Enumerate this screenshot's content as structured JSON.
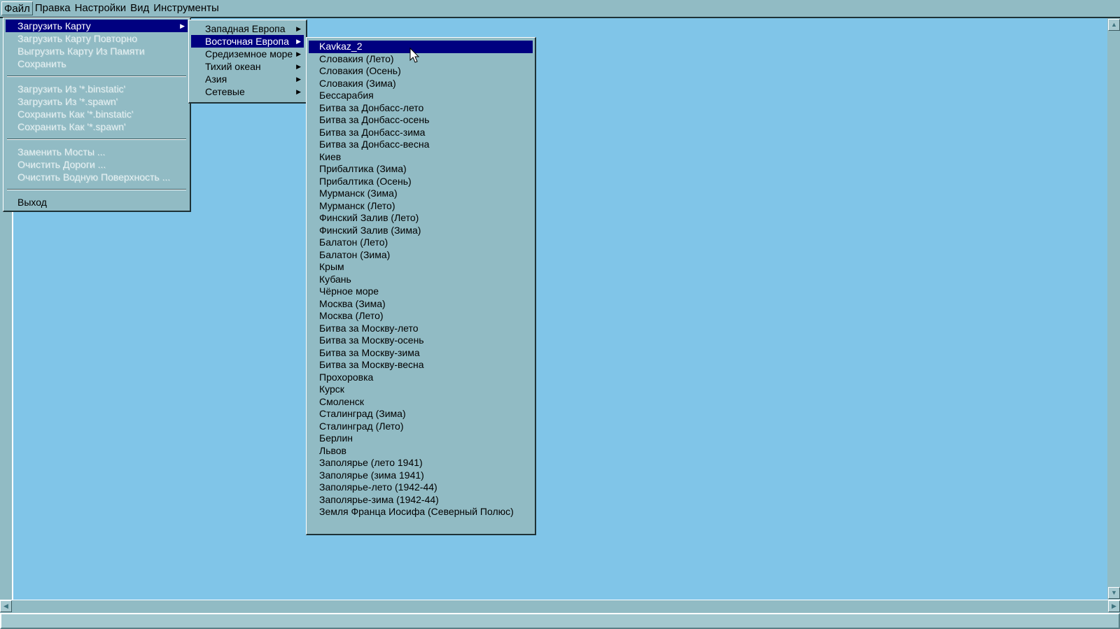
{
  "menubar": {
    "items": [
      "Файл",
      "Правка",
      "Настройки",
      "Вид",
      "Инструменты"
    ]
  },
  "file_menu": {
    "load_map": "Загрузить Карту",
    "reload_map": "Загрузить Карту Повторно",
    "unload_map": "Выгрузить Карту Из Памяти",
    "save": "Сохранить",
    "load_binstatic": "Загрузить Из '*.binstatic'",
    "load_spawn": "Загрузить Из '*.spawn'",
    "save_binstatic": "Сохранить Как '*.binstatic'",
    "save_spawn": "Сохранить Как '*.spawn'",
    "replace_bridges": "Заменить Мосты ...",
    "clear_roads": "Очистить Дороги ...",
    "clear_water": "Очистить Водную Поверхность ...",
    "exit": "Выход"
  },
  "regions_menu": {
    "items": [
      "Западная Европа",
      "Восточная Европа",
      "Средиземное море",
      "Тихий океан",
      "Азия",
      "Сетевые"
    ],
    "selected": 1
  },
  "maps_menu": {
    "selected": 0,
    "items": [
      "Kavkaz_2",
      "Словакия (Лето)",
      "Словакия (Осень)",
      "Словакия (Зима)",
      "Бессарабия",
      "Битва за Донбасс-лето",
      "Битва за Донбасс-осень",
      "Битва за Донбасс-зима",
      "Битва за Донбасс-весна",
      "Киев",
      "Прибалтика (Зима)",
      "Прибалтика (Осень)",
      "Мурманск (Зима)",
      "Мурманск (Лето)",
      "Финский Залив (Лето)",
      "Финский Залив (Зима)",
      "Балатон (Лето)",
      "Балатон (Зима)",
      "Крым",
      "Кубань",
      "Чёрное море",
      "Москва (Зима)",
      "Москва (Лето)",
      "Битва за Москву-лето",
      "Битва за Москву-осень",
      "Битва за Москву-зима",
      "Битва за Москву-весна",
      "Прохоровка",
      "Курск",
      "Смоленск",
      "Сталинград (Зима)",
      "Сталинград (Лето)",
      "Берлин",
      "Львов",
      "Заполярье (лето 1941)",
      "Заполярье (зима 1941)",
      "Заполярье-лето (1942-44)",
      "Заполярье-зима (1942-44)",
      "Земля Франца Иосифа (Северный Полюс)"
    ]
  },
  "colors": {
    "menu_bg": "#91bbc4",
    "highlight": "#000080",
    "workspace": "#80c5e8"
  }
}
